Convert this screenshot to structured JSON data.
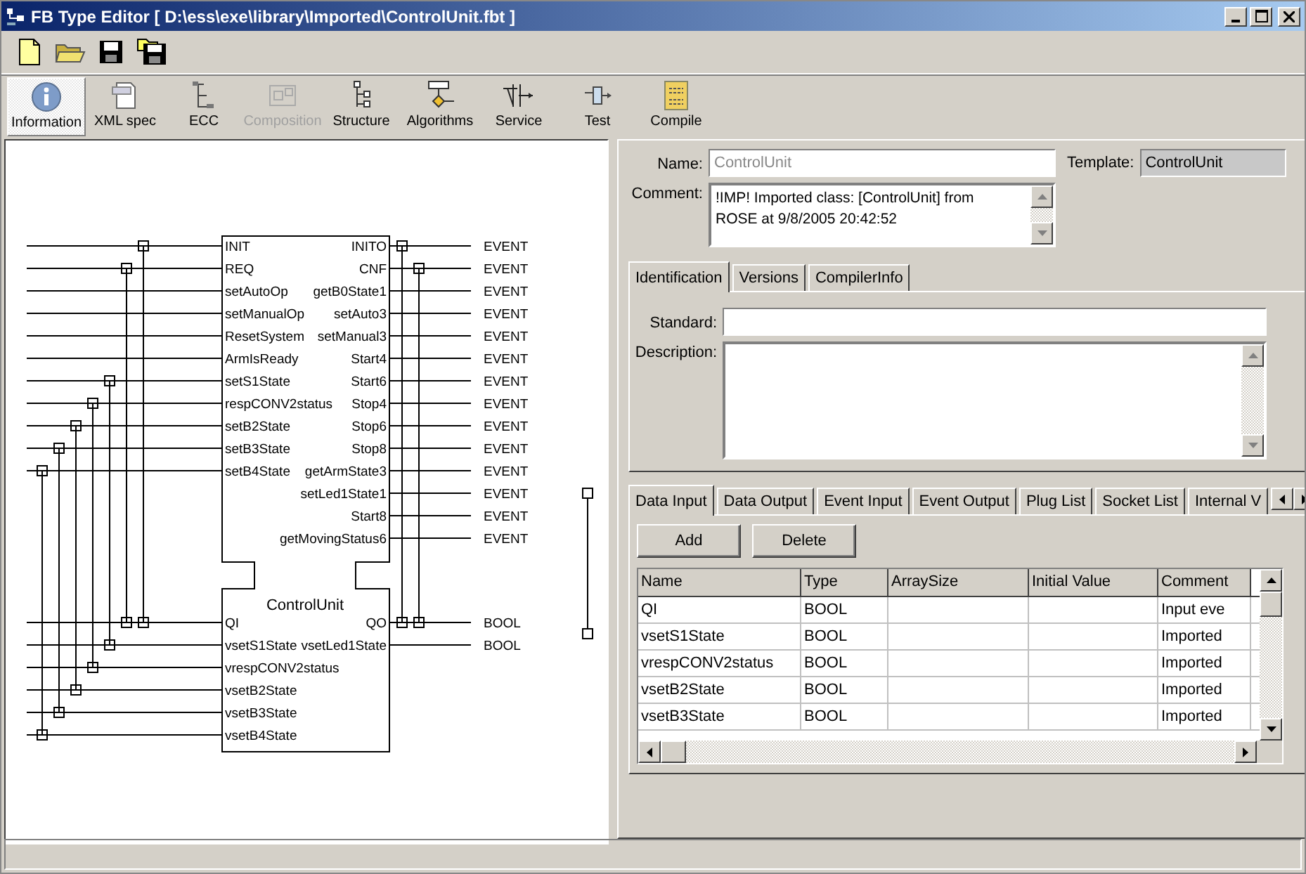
{
  "window": {
    "title": "FB Type Editor [ D:\\ess\\exe\\library\\Imported\\ControlUnit.fbt ]"
  },
  "views": [
    {
      "label": "Information",
      "selected": true,
      "disabled": false
    },
    {
      "label": "XML spec",
      "selected": false,
      "disabled": false
    },
    {
      "label": "ECC",
      "selected": false,
      "disabled": false
    },
    {
      "label": "Composition",
      "selected": false,
      "disabled": true
    },
    {
      "label": "Structure",
      "selected": false,
      "disabled": false
    },
    {
      "label": "Algorithms",
      "selected": false,
      "disabled": false
    },
    {
      "label": "Service",
      "selected": false,
      "disabled": false
    },
    {
      "label": "Test",
      "selected": false,
      "disabled": false
    },
    {
      "label": "Compile",
      "selected": false,
      "disabled": false
    }
  ],
  "diagram": {
    "block": {
      "name": "ControlUnit",
      "event_inputs": [
        {
          "name": "INIT"
        },
        {
          "name": "REQ"
        },
        {
          "name": "setAutoOp"
        },
        {
          "name": "setManualOp"
        },
        {
          "name": "ResetSystem"
        },
        {
          "name": "ArmIsReady"
        },
        {
          "name": "setS1State"
        },
        {
          "name": "respCONV2status"
        },
        {
          "name": "setB2State"
        },
        {
          "name": "setB3State"
        },
        {
          "name": "setB4State"
        }
      ],
      "event_outputs": [
        {
          "name": "INITO",
          "type": "EVENT"
        },
        {
          "name": "CNF",
          "type": "EVENT"
        },
        {
          "name": "getB0State1",
          "type": "EVENT"
        },
        {
          "name": "setAuto3",
          "type": "EVENT"
        },
        {
          "name": "setManual3",
          "type": "EVENT"
        },
        {
          "name": "Start4",
          "type": "EVENT"
        },
        {
          "name": "Start6",
          "type": "EVENT"
        },
        {
          "name": "Stop4",
          "type": "EVENT"
        },
        {
          "name": "Stop6",
          "type": "EVENT"
        },
        {
          "name": "Stop8",
          "type": "EVENT"
        },
        {
          "name": "getArmState3",
          "type": "EVENT"
        },
        {
          "name": "setLed1State1",
          "type": "EVENT"
        },
        {
          "name": "Start8",
          "type": "EVENT"
        },
        {
          "name": "getMovingStatus6",
          "type": "EVENT"
        }
      ],
      "data_inputs": [
        {
          "name": "QI"
        },
        {
          "name": "vsetS1State"
        },
        {
          "name": "vrespCONV2status"
        },
        {
          "name": "vsetB2State"
        },
        {
          "name": "vsetB3State"
        },
        {
          "name": "vsetB4State"
        }
      ],
      "data_outputs": [
        {
          "name": "QO",
          "type": "BOOL"
        },
        {
          "name": "vsetLed1State",
          "type": "BOOL"
        }
      ]
    }
  },
  "form": {
    "name_label": "Name:",
    "name_value": "ControlUnit",
    "template_label": "Template:",
    "template_value": "ControlUnit",
    "comment_label": "Comment:",
    "comment_value": "!IMP! Imported class: [ControlUnit] from ROSE at 9/8/2005 20:42:52"
  },
  "info_tabs": [
    {
      "label": "Identification",
      "selected": true
    },
    {
      "label": "Versions",
      "selected": false
    },
    {
      "label": "CompilerInfo",
      "selected": false
    }
  ],
  "identification": {
    "standard_label": "Standard:",
    "description_label": "Description:"
  },
  "var_tabs": [
    {
      "label": "Data Input",
      "selected": true
    },
    {
      "label": "Data Output",
      "selected": false
    },
    {
      "label": "Event Input",
      "selected": false
    },
    {
      "label": "Event Output",
      "selected": false
    },
    {
      "label": "Plug List",
      "selected": false
    },
    {
      "label": "Socket List",
      "selected": false
    },
    {
      "label": "Internal V",
      "selected": false
    }
  ],
  "buttons": [
    "Add",
    "Delete"
  ],
  "table": {
    "columns": [
      "Name",
      "Type",
      "ArraySize",
      "Initial Value",
      "Comment"
    ],
    "rows": [
      {
        "name": "QI",
        "type": "BOOL",
        "comment": "Input eve"
      },
      {
        "name": "vsetS1State",
        "type": "BOOL",
        "comment": "Imported"
      },
      {
        "name": "vrespCONV2status",
        "type": "BOOL",
        "comment": "Imported"
      },
      {
        "name": "vsetB2State",
        "type": "BOOL",
        "comment": "Imported"
      },
      {
        "name": "vsetB3State",
        "type": "BOOL",
        "comment": "Imported"
      }
    ]
  }
}
